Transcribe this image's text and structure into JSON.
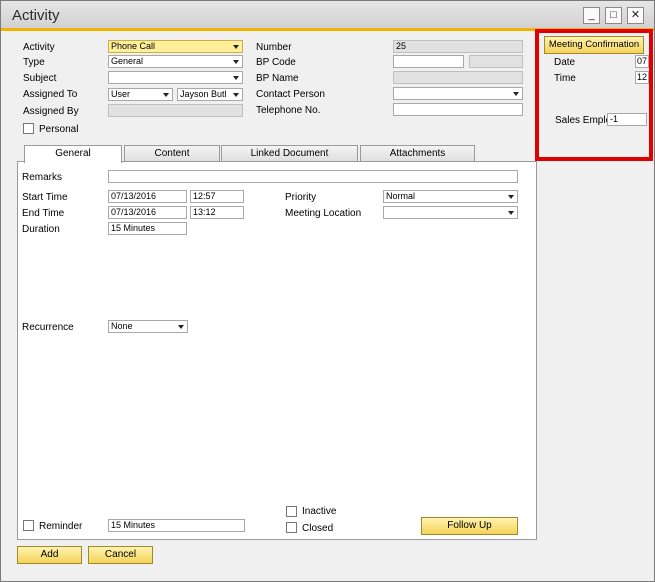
{
  "window": {
    "title": "Activity",
    "controls": [
      "minimize-icon",
      "maximize-icon",
      "close-icon"
    ]
  },
  "header": {
    "activity_label": "Activity",
    "activity_value": "Phone Call",
    "type_label": "Type",
    "type_value": "General",
    "subject_label": "Subject",
    "subject_value": "",
    "assigned_to_label": "Assigned To",
    "assigned_to_type": "User",
    "assigned_to_name": "Jayson Butl",
    "assigned_by_label": "Assigned By",
    "personal_label": "Personal",
    "number_label": "Number",
    "number_value": "25",
    "bp_code_label": "BP Code",
    "bp_name_label": "BP Name",
    "contact_person_label": "Contact Person",
    "telephone_label": "Telephone No."
  },
  "tabs": [
    "General",
    "Content",
    "Linked Document",
    "Attachments"
  ],
  "general": {
    "remarks_label": "Remarks",
    "start_time_label": "Start Time",
    "start_date": "07/13/2016",
    "start_time": "12:57",
    "end_time_label": "End Time",
    "end_date": "07/13/2016",
    "end_time": "13:12",
    "duration_label": "Duration",
    "duration_value": "15 Minutes",
    "priority_label": "Priority",
    "priority_value": "Normal",
    "meeting_location_label": "Meeting Location",
    "recurrence_label": "Recurrence",
    "recurrence_value": "None",
    "reminder_label": "Reminder",
    "reminder_value": "15 Minutes",
    "inactive_label": "Inactive",
    "closed_label": "Closed",
    "follow_up_label": "Follow Up"
  },
  "side_panel": {
    "meeting_confirmation_label": "Meeting Confirmation",
    "date_label": "Date",
    "date_value": "07",
    "time_label": "Time",
    "time_value": "12",
    "sales_employee_label": "Sales Emplo",
    "sales_employee_value": "-1"
  },
  "footer": {
    "add_label": "Add",
    "cancel_label": "Cancel"
  },
  "colors": {
    "accent": "#f0b400",
    "highlight": "#e00000",
    "yellow_field": "#ffef9b"
  }
}
